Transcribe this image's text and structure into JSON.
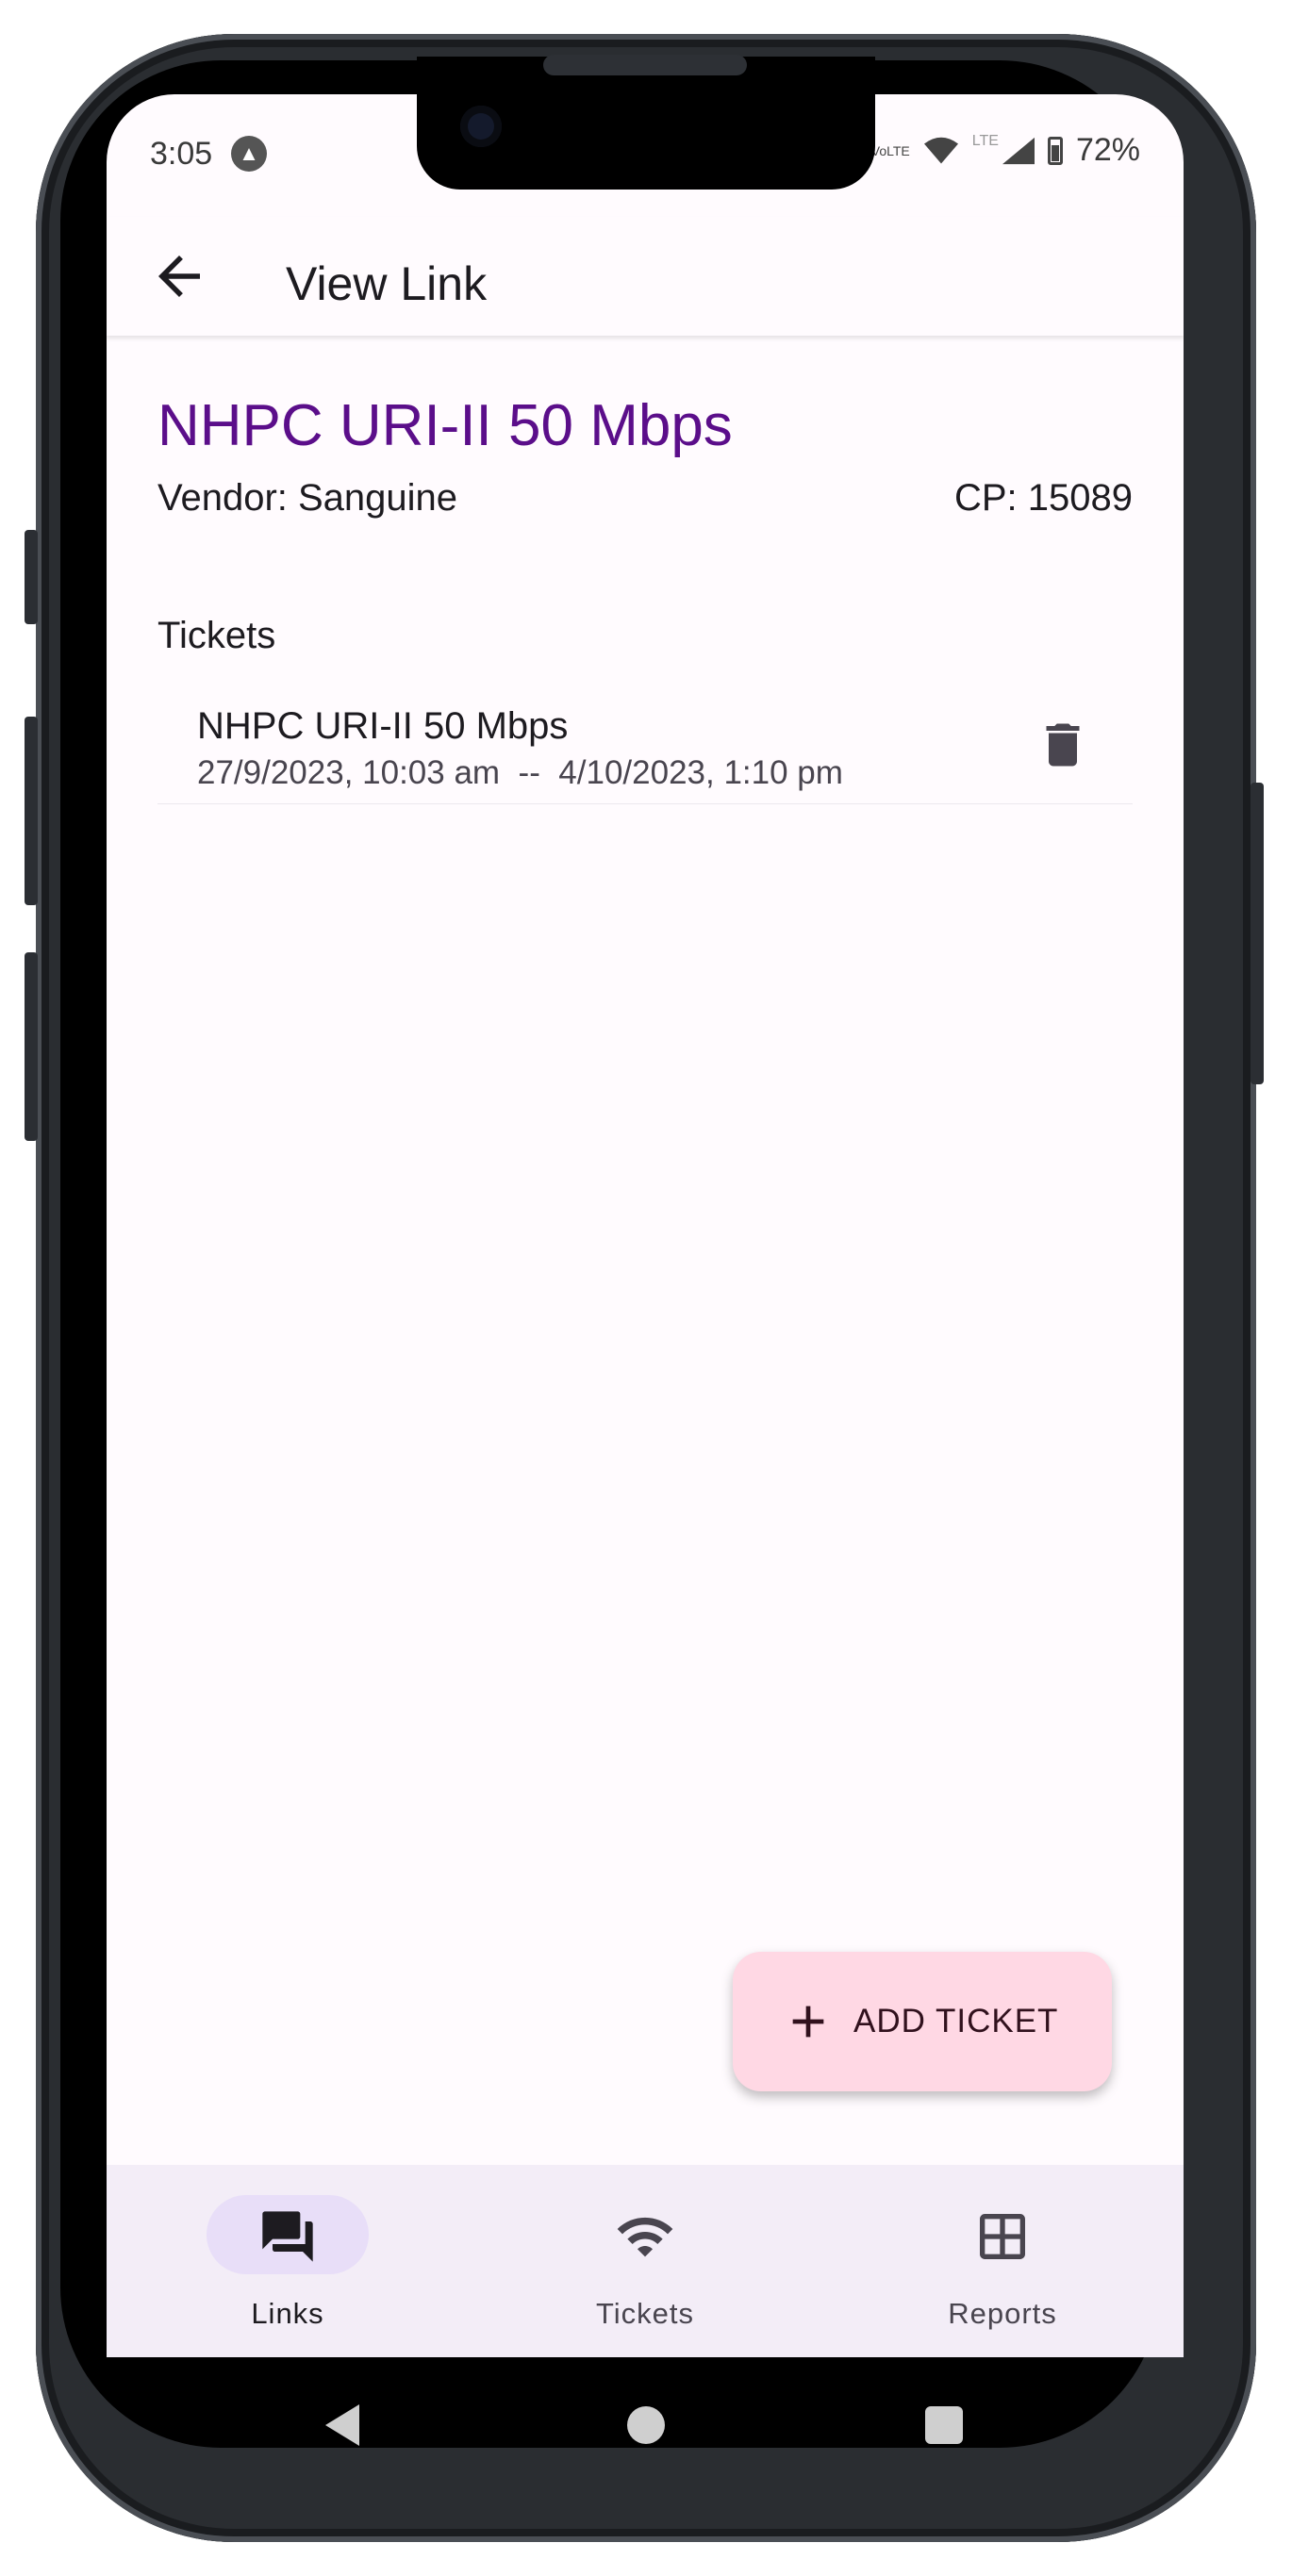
{
  "status_bar": {
    "time": "3:05",
    "network_badge": "VoLTE",
    "lte_label": "LTE",
    "battery": "72%"
  },
  "app_bar": {
    "title": "View Link"
  },
  "link": {
    "name": "NHPC URI-II 50 Mbps",
    "vendor": "Vendor: Sanguine",
    "cp": "CP: 15089"
  },
  "tickets_section": {
    "title": "Tickets",
    "items": [
      {
        "title": "NHPC URI-II 50 Mbps",
        "dates": "27/9/2023, 10:03 am  --  4/10/2023, 1:10 pm"
      }
    ]
  },
  "fab": {
    "label": "ADD TICKET"
  },
  "bottom_nav": {
    "items": [
      {
        "label": "Links",
        "icon": "forum-icon",
        "active": true
      },
      {
        "label": "Tickets",
        "icon": "wifi-icon",
        "active": false
      },
      {
        "label": "Reports",
        "icon": "table-icon",
        "active": false
      }
    ]
  },
  "colors": {
    "accent_title": "#5b0e8a",
    "fab_background": "#ffd8e4",
    "nav_background": "#f3edf7",
    "nav_active_pill": "#e8def8"
  }
}
